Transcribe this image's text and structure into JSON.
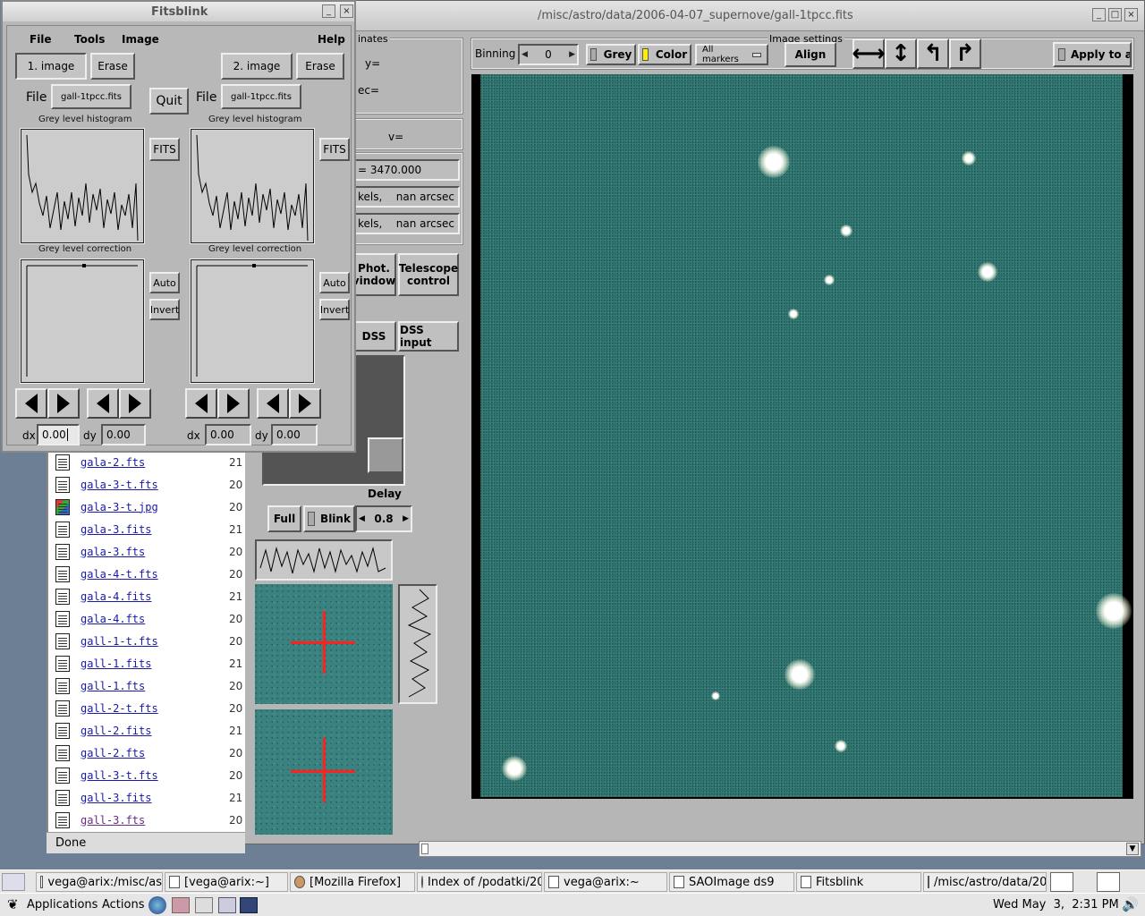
{
  "main_window": {
    "title": "/misc/astro/data/2006-04-07_supernove/gall-1tpcc.fits",
    "coords_label": "inates",
    "y_label": "y=",
    "dec_label": "ec=",
    "v_label": "v=",
    "value_field": "= 3470.000",
    "pixels_row1": "kels,",
    "arcsec_row1": "nan arcsec",
    "pixels_row2": "kels,",
    "arcsec_row2": "nan arcsec",
    "phot_window": "Phot.\nvindow",
    "telescope_control": "Telescope\ncontrol",
    "dss": "DSS",
    "dss_input": "DSS input",
    "delay_label": "Delay",
    "full": "Full",
    "blink": "Blink",
    "delay_value": "0.8",
    "binning_label": "Binning",
    "binning_value": "0",
    "grey": "Grey",
    "color": "Color",
    "markers": "All markers",
    "image_settings": "Image settings",
    "align": "Align",
    "apply": "Apply to al"
  },
  "file_list": {
    "status": "Done",
    "items": [
      {
        "name": "gala-2.fts",
        "date": "21"
      },
      {
        "name": "gala-3-t.fts",
        "date": "20"
      },
      {
        "name": "gala-3-t.jpg",
        "date": "20"
      },
      {
        "name": "gala-3.fits",
        "date": "21"
      },
      {
        "name": "gala-3.fts",
        "date": "20"
      },
      {
        "name": "gala-4-t.fts",
        "date": "20"
      },
      {
        "name": "gala-4.fits",
        "date": "21"
      },
      {
        "name": "gala-4.fts",
        "date": "20"
      },
      {
        "name": "gall-1-t.fts",
        "date": "20"
      },
      {
        "name": "gall-1.fits",
        "date": "21"
      },
      {
        "name": "gall-1.fts",
        "date": "20"
      },
      {
        "name": "gall-2-t.fts",
        "date": "20"
      },
      {
        "name": "gall-2.fits",
        "date": "21"
      },
      {
        "name": "gall-2.fts",
        "date": "20"
      },
      {
        "name": "gall-3-t.fts",
        "date": "20"
      },
      {
        "name": "gall-3.fits",
        "date": "21"
      },
      {
        "name": "gall-3.fts",
        "date": "20"
      }
    ]
  },
  "fitsblink": {
    "title": "Fitsblink",
    "menu_file": "File",
    "menu_tools": "Tools",
    "menu_image": "Image",
    "menu_help": "Help",
    "image1": "1. image",
    "image2": "2. image",
    "erase": "Erase",
    "quit": "Quit",
    "file_label": "File",
    "file1": "gall-1tpcc.fits",
    "file2": "gall-1tpcc.fits",
    "hist_label": "Grey level histogram",
    "corr_label": "Grey level correction",
    "fits_btn": "FITS",
    "auto_btn": "Auto",
    "invert_btn": "Invert",
    "dx_label": "dx",
    "dy_label": "dy",
    "dx1": "0.00",
    "dy1": "0.00",
    "dx2": "0.00",
    "dy2": "0.00"
  },
  "taskbar": {
    "tasks": [
      "vega@arix:/misc/as",
      "[vega@arix:~]",
      "[Mozilla Firefox]",
      "Index of /podatki/20",
      "vega@arix:~",
      "SAOImage ds9",
      "Fitsblink",
      "/misc/astro/data/200"
    ]
  },
  "panel": {
    "applications": "Applications",
    "actions": "Actions",
    "clock": "Wed May  3,  2:31 PM"
  },
  "colors": {
    "image_teal": "#2f7772",
    "desktop": "#6d7f94",
    "crosshair": "#ff2020"
  }
}
